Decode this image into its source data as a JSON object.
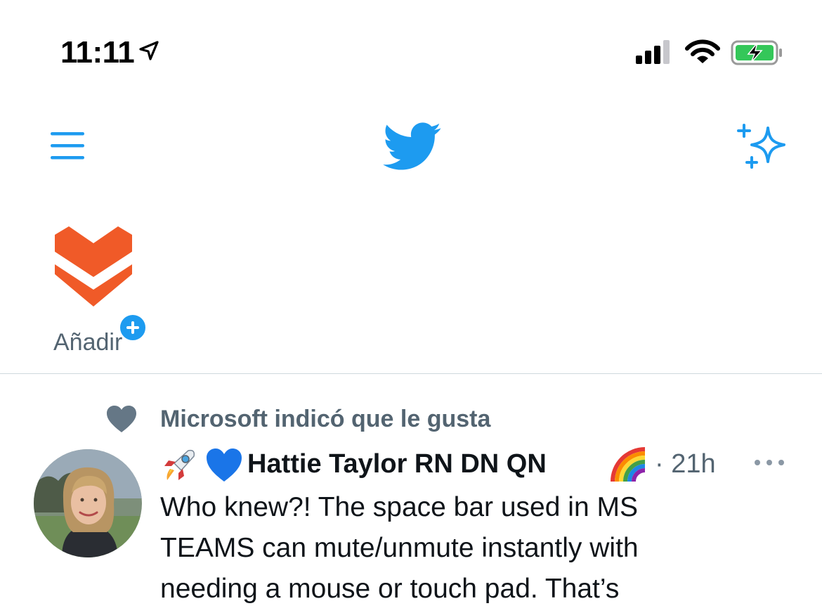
{
  "status_bar": {
    "time": "11:11",
    "icons": [
      "location-arrow-icon",
      "cellular-signal-icon",
      "wifi-icon",
      "battery-charging-icon"
    ]
  },
  "nav": {
    "icons": [
      "hamburger-menu-icon",
      "twitter-bird-icon",
      "sparkle-icon"
    ],
    "accent_color": "#1d9bf0"
  },
  "fleets": {
    "add_label": "Añadir",
    "logo_color": "#f05a28"
  },
  "tweet": {
    "social_context": "Microsoft indicó que le gusta",
    "author_emojis_before": [
      "rocket-emoji",
      "blue-heart-emoji"
    ],
    "author_name": "Hattie Taylor RN DN QN",
    "author_emoji_after": "rainbow-emoji",
    "meta": "· 21h",
    "text_lines": [
      "Who knew?! The space bar used in MS",
      "TEAMS can mute/unmute instantly with",
      "needing a mouse or touch pad. That’s"
    ]
  },
  "colors": {
    "text_primary": "#0f1419",
    "text_secondary": "#536471",
    "divider": "#cfd9de"
  }
}
